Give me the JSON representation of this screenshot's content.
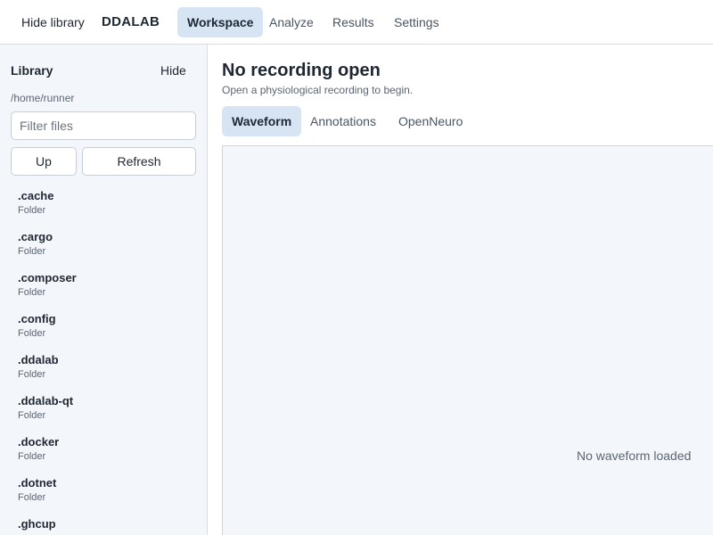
{
  "topbar": {
    "hide_library": "Hide library",
    "brand": "DDALAB",
    "tabs": [
      {
        "label": "Workspace",
        "active": true
      },
      {
        "label": "Analyze",
        "active": false
      },
      {
        "label": "Results",
        "active": false
      },
      {
        "label": "Settings",
        "active": false
      }
    ]
  },
  "sidebar": {
    "title": "Library",
    "hide_label": "Hide",
    "path": "/home/runner",
    "filter_placeholder": "Filter files",
    "filter_value": "",
    "up_label": "Up",
    "refresh_label": "Refresh",
    "items": [
      {
        "name": ".cache",
        "type": "Folder"
      },
      {
        "name": ".cargo",
        "type": "Folder"
      },
      {
        "name": ".composer",
        "type": "Folder"
      },
      {
        "name": ".config",
        "type": "Folder"
      },
      {
        "name": ".ddalab",
        "type": "Folder"
      },
      {
        "name": ".ddalab-qt",
        "type": "Folder"
      },
      {
        "name": ".docker",
        "type": "Folder"
      },
      {
        "name": ".dotnet",
        "type": "Folder"
      },
      {
        "name": ".ghcup",
        "type": ""
      }
    ]
  },
  "main": {
    "title": "No recording open",
    "subtitle": "Open a physiological recording to begin.",
    "tabs": [
      {
        "label": "Waveform",
        "active": true
      },
      {
        "label": "Annotations",
        "active": false
      },
      {
        "label": "OpenNeuro",
        "active": false
      }
    ],
    "empty_message": "No waveform loaded"
  },
  "colors": {
    "accent_bg": "#d6e4f4",
    "sidebar_bg": "#f3f6fa",
    "panel_bg": "#f3f6fa",
    "border": "#d9dde3",
    "text": "#1f2733",
    "muted_text": "#5c6673"
  }
}
